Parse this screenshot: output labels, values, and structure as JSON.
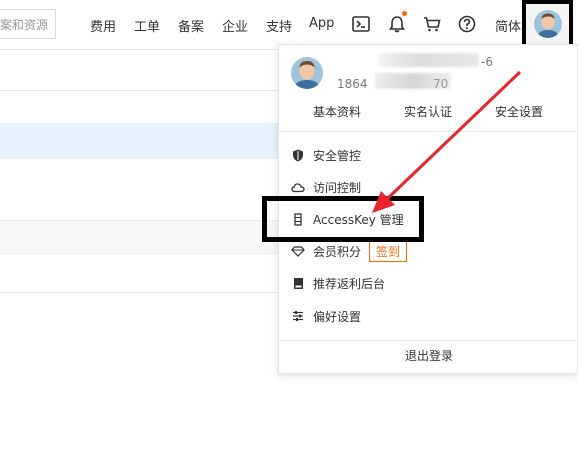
{
  "header": {
    "search_placeholder": "案和资源",
    "nav": [
      "费用",
      "工单",
      "备案",
      "企业",
      "支持",
      "App"
    ],
    "lang": "简体",
    "icons": [
      "terminal-icon",
      "bell-icon",
      "cart-icon",
      "help-icon"
    ],
    "notification_dot_color": "#ff6a00"
  },
  "account": {
    "name_tail": "-6",
    "id_prefix": "1864",
    "id_tail": "70",
    "links": [
      "基本资料",
      "实名认证",
      "安全设置"
    ]
  },
  "menu": [
    {
      "icon": "shield-icon",
      "label": "安全管控"
    },
    {
      "icon": "cloud-icon",
      "label": "访问控制"
    },
    {
      "icon": "key-icon",
      "label": "AccessKey 管理"
    },
    {
      "icon": "diamond-icon",
      "label": "会员积分",
      "badge": "签到"
    },
    {
      "icon": "book-icon",
      "label": "推荐返利后台"
    },
    {
      "icon": "sliders-icon",
      "label": "偏好设置"
    }
  ],
  "logout_label": "退出登录",
  "colors": {
    "accent": "#ff6a00",
    "annotation_arrow": "#e8242c",
    "row_highlight": "#e6f2fc"
  }
}
